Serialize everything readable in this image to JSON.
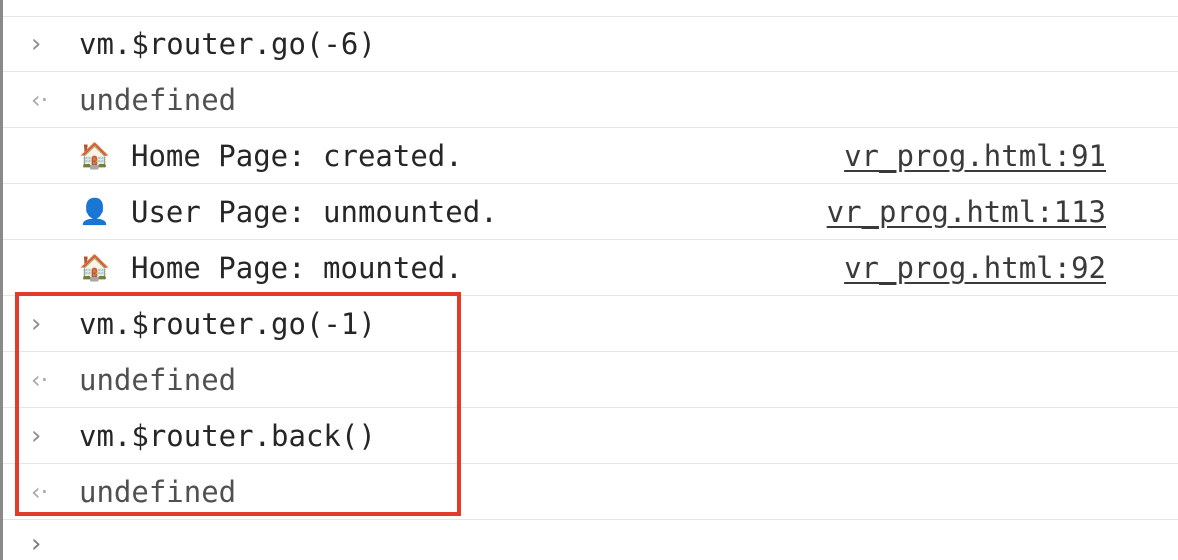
{
  "console": {
    "clipped_top_text": "          ",
    "entries": [
      {
        "kind": "command",
        "prompt_glyph": "›",
        "text": "vm.$router.go(-6)"
      },
      {
        "kind": "result",
        "result_glyph": "‹·",
        "text": "undefined"
      },
      {
        "kind": "log",
        "icon": "house-emoji-icon",
        "icon_glyph": "🏠",
        "text": "Home Page: created.",
        "source": "vr_prog.html:91"
      },
      {
        "kind": "log",
        "icon": "user-silhouette-icon",
        "icon_glyph": "👤",
        "text": "User Page: unmounted.",
        "source": "vr_prog.html:113"
      },
      {
        "kind": "log",
        "icon": "house-emoji-icon",
        "icon_glyph": "🏠",
        "text": "Home Page: mounted.",
        "source": "vr_prog.html:92"
      },
      {
        "kind": "command",
        "prompt_glyph": "›",
        "text": "vm.$router.go(-1)"
      },
      {
        "kind": "result",
        "result_glyph": "‹·",
        "text": "undefined"
      },
      {
        "kind": "command",
        "prompt_glyph": "›",
        "text": "vm.$router.back()"
      },
      {
        "kind": "result",
        "result_glyph": "‹·",
        "text": "undefined"
      }
    ],
    "input_prompt_glyph": "›"
  },
  "colors": {
    "highlight_border": "#e23b2a",
    "row_divider": "#e6e6e6",
    "left_border": "#8a8a8a"
  }
}
